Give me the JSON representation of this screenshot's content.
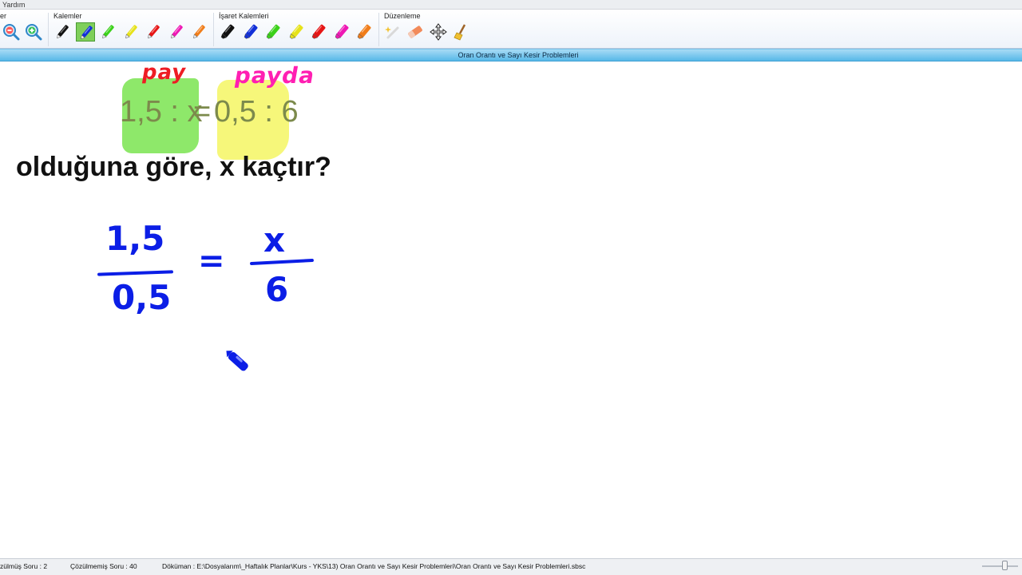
{
  "menubar": {
    "help": "Yardım"
  },
  "ribbon": {
    "groups": {
      "first_label_fragment": "er",
      "pens": "Kalemler",
      "markers": "İşaret Kalemleri",
      "edit": "Düzenleme"
    },
    "tools": {
      "zoom_out": "zoom-out-icon",
      "zoom_in": "zoom-in-icon",
      "pen_colors": [
        "#111111",
        "#1230d8",
        "#3bd11a",
        "#e6e21a",
        "#e61515",
        "#ee18b4",
        "#f07d1a"
      ],
      "marker_colors": [
        "#111111",
        "#1230d8",
        "#3bd11a",
        "#e6e21a",
        "#e61515",
        "#ee18b4",
        "#f07d1a"
      ],
      "edit_tools": [
        "magic-wand-icon",
        "eraser-icon",
        "move-icon",
        "broom-icon"
      ]
    }
  },
  "document_title": "Oran Orantı ve Sayı Kesir Problemleri",
  "canvas": {
    "equation_left": "1,5 : x",
    "equals": "=",
    "equation_right": "0,5 : 6",
    "question": "olduğuna göre, x kaçtır?",
    "annotation_red": "pay",
    "annotation_magenta": "payda",
    "fraction_left_numerator": "1,5",
    "fraction_left_denominator": "0,5",
    "fraction_equals": "=",
    "fraction_right_numerator": "x",
    "fraction_right_denominator": "6",
    "colors": {
      "highlight_green": "#8ee86a",
      "highlight_yellow": "#f6f77a",
      "ink_blue": "#0b1ee6",
      "ink_red": "#ee1d24",
      "ink_magenta": "#ff1fb2"
    }
  },
  "status": {
    "solved": "zülmüş Soru : 2",
    "unsolved": "Çözülmemiş Soru : 40",
    "document": "Döküman : E:\\Dosyalarım\\_Haftalık Planlar\\Kurs - YKS\\13) Oran Orantı ve Sayı Kesir Problemleri\\Oran Orantı ve Sayı Kesir Problemleri.sbsc"
  }
}
